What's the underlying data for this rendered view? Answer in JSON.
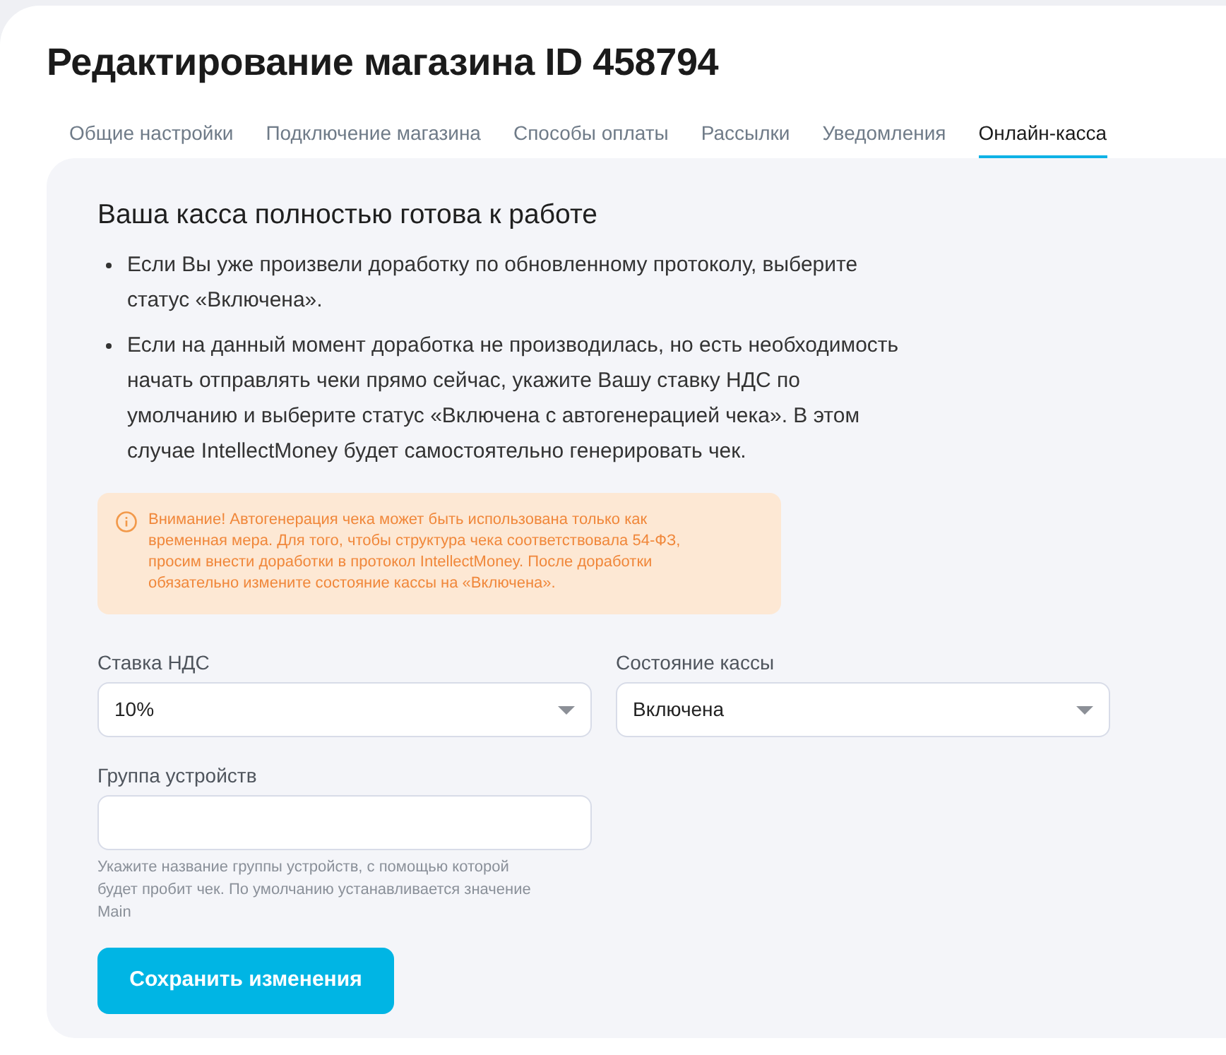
{
  "page": {
    "title": "Редактирование магазина ID 458794"
  },
  "tabs": [
    {
      "label": "Общие настройки",
      "selected": false
    },
    {
      "label": "Подключение магазина",
      "selected": false
    },
    {
      "label": "Способы оплаты",
      "selected": false
    },
    {
      "label": "Рассылки",
      "selected": false
    },
    {
      "label": "Уведомления",
      "selected": false
    },
    {
      "label": "Онлайн-касса",
      "selected": true
    }
  ],
  "panel": {
    "heading": "Ваша касса полностью готова к работе",
    "bullets": [
      "Если Вы уже произвели доработку по обновленному протоколу, выберите статус «Включена».",
      "Если на данный момент доработка не производилась, но есть необходимость начать отправлять чеки прямо сейчас, укажите Вашу ставку НДС по умолчанию и выберите статус «Включена с автогенерацией чека». В этом случае IntellectMoney будет самостоятельно генерировать чек."
    ],
    "warning": {
      "text": "Внимание! Автогенерация чека может быть использована только как временная мера. Для того, чтобы структура чека соответствовала 54-ФЗ, просим внести доработки в протокол IntellectMoney. После доработки обязательно измените состояние кассы на «Включена»."
    },
    "fields": [
      {
        "kind": "select",
        "label": "Ставка НДС",
        "value": "10%"
      },
      {
        "kind": "select",
        "label": "Состояние кассы",
        "value": "Включена"
      },
      {
        "kind": "input",
        "label": "Группа устройств",
        "help_text": "Укажите название группы устройств, с помощью которой будет пробит чек. По умолчанию устанавливается значение Main"
      }
    ],
    "save_button": {
      "label": "Сохранить изменения"
    }
  }
}
